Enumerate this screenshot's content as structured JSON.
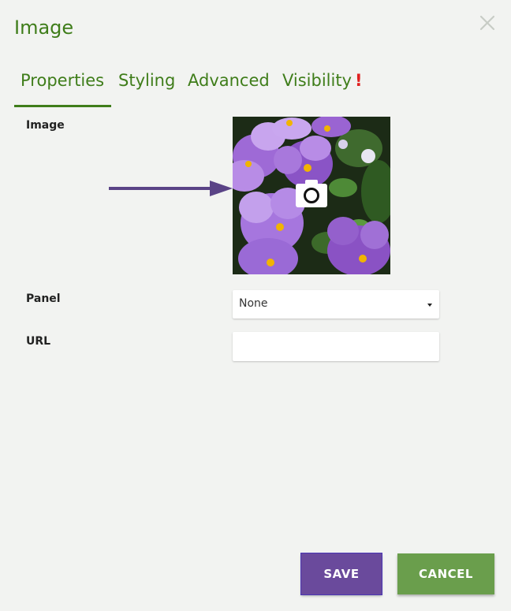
{
  "dialog": {
    "title": "Image",
    "close_icon": "close-icon"
  },
  "tabs": [
    {
      "label": "Properties",
      "active": true
    },
    {
      "label": "Styling",
      "active": false
    },
    {
      "label": "Advanced",
      "active": false
    },
    {
      "label": "Visibility",
      "active": false,
      "alert": "!"
    }
  ],
  "form": {
    "image_label": "Image",
    "image_icon": "camera-icon",
    "panel_label": "Panel",
    "panel_value": "None",
    "url_label": "URL",
    "url_value": "",
    "url_placeholder": ""
  },
  "buttons": {
    "save": "SAVE",
    "cancel": "CANCEL"
  },
  "colors": {
    "accent": "#3f7d1a",
    "save": "#6a4a9c",
    "cancel": "#6a9e4c",
    "alert": "#e02020",
    "arrow": "#5a4386"
  }
}
